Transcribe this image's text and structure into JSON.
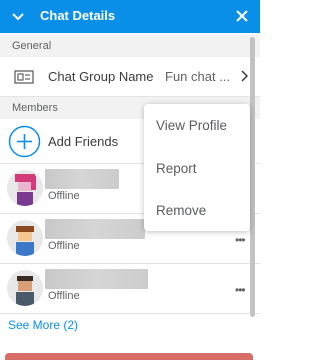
{
  "header": {
    "title": "Chat Details",
    "bg_color": "#0a8fe8",
    "back_icon": "chevron-down-icon",
    "close_icon": "close-icon"
  },
  "general": {
    "section_label": "General",
    "chat_group_name_label": "Chat Group Name",
    "chat_group_name_value": "Fun chat ..."
  },
  "members": {
    "section_label": "Members",
    "add_friends_label": "Add Friends",
    "list": [
      {
        "status": "Offline"
      },
      {
        "status": "Offline",
        "more": "•••"
      },
      {
        "status": "Offline",
        "more": "•••"
      }
    ],
    "see_more": "See More (2)"
  },
  "context_menu": {
    "items": [
      "View Profile",
      "Report",
      "Remove"
    ]
  },
  "colors": {
    "accent": "#0a8fe8",
    "danger": "#d86d68"
  }
}
